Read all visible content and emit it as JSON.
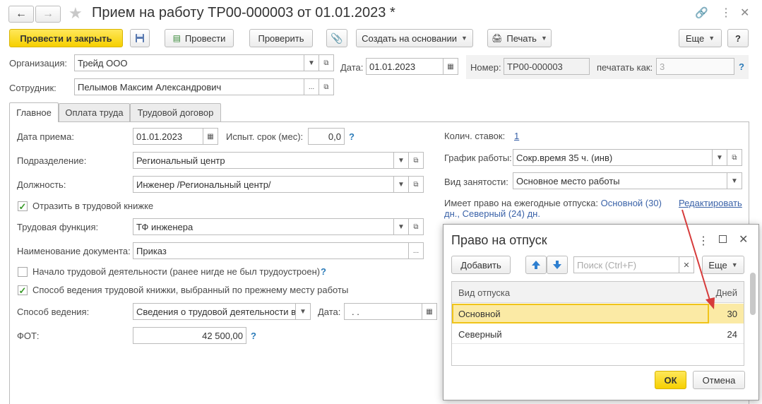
{
  "window": {
    "title": "Прием на работу ТР00-000003 от 01.01.2023 *",
    "nav_back": "←",
    "nav_forward": "→",
    "star": "★"
  },
  "toolbar": {
    "post_close": "Провести и закрыть",
    "post": "Провести",
    "check": "Проверить",
    "create_based": "Создать на основании",
    "print": "Печать",
    "more": "Еще",
    "help": "?"
  },
  "header": {
    "org_label": "Организация:",
    "org_value": "Трейд ООО",
    "date_label": "Дата:",
    "date_value": "01.01.2023",
    "number_label": "Номер:",
    "number_value": "ТР00-000003",
    "print_as_label": "печатать как:",
    "print_as_value": "3",
    "employee_label": "Сотрудник:",
    "employee_value": "Пелымов Максим Александрович"
  },
  "tabs": [
    {
      "label": "Главное"
    },
    {
      "label": "Оплата труда"
    },
    {
      "label": "Трудовой договор"
    }
  ],
  "main": {
    "hire_date_label": "Дата приема:",
    "hire_date_value": "01.01.2023",
    "probation_label": "Испыт. срок (мес):",
    "probation_value": "0,0",
    "dept_label": "Подразделение:",
    "dept_value": "Региональный центр",
    "position_label": "Должность:",
    "position_value": "Инженер /Региональный центр/",
    "workbook_checkbox": "Отразить в трудовой книжке",
    "labor_function_label": "Трудовая функция:",
    "labor_function_value": "ТФ инженера",
    "doc_name_label": "Наименование документа:",
    "doc_name_value": "Приказ",
    "start_work_checkbox": "Начало трудовой деятельности (ранее нигде не был трудоустроен)",
    "method_checkbox": "Способ ведения трудовой книжки, выбранный по прежнему месту работы",
    "method_label": "Способ ведения:",
    "method_value": "Сведения о трудовой деятельности в",
    "method_date_label": "Дата:",
    "method_date_value": ".  .",
    "fot_label": "ФОТ:",
    "fot_value": "42 500,00"
  },
  "right": {
    "rates_label": "Колич. ставок:",
    "rates_value": "1",
    "schedule_label": "График работы:",
    "schedule_value": "Сокр.время 35 ч. (инв)",
    "employment_label": "Вид занятости:",
    "employment_value": "Основное место работы",
    "leave_text_1": "Имеет право на ежегодные отпуска:",
    "leave_text_link1": "Основной (30)",
    "leave_text_link2": "дн., Северный (24) дн.",
    "edit_link": "Редактировать"
  },
  "dialog": {
    "title": "Право на отпуск",
    "add_button": "Добавить",
    "search_placeholder": "Поиск (Ctrl+F)",
    "more": "Еще",
    "col_type": "Вид отпуска",
    "col_days": "Дней",
    "rows": [
      {
        "type": "Основной",
        "days": "30"
      },
      {
        "type": "Северный",
        "days": "24"
      }
    ],
    "ok": "ОК",
    "cancel": "Отмена"
  },
  "colors": {
    "accent_yellow": "#f6d000",
    "selected_row": "#fbeaa5",
    "arrow": "#d63b3b",
    "link": "#3a62a8"
  }
}
